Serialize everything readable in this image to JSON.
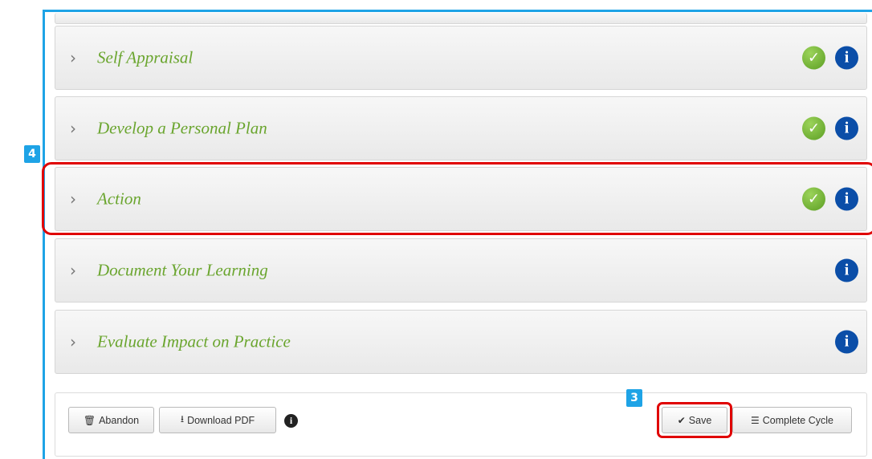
{
  "steps": [
    {
      "title": "Self Appraisal",
      "complete": true
    },
    {
      "title": "Develop a Personal Plan",
      "complete": true
    },
    {
      "title": "Action",
      "complete": true
    },
    {
      "title": "Document Your Learning",
      "complete": false
    },
    {
      "title": "Evaluate Impact on Practice",
      "complete": false
    }
  ],
  "footer": {
    "abandon_label": "Abandon",
    "download_label": "Download PDF",
    "save_label": "Save",
    "complete_label": "Complete Cycle"
  },
  "badges": {
    "step_badge": "4",
    "save_badge": "3"
  },
  "colors": {
    "accent": "#1ea3e6",
    "highlight": "#e00000",
    "step_title": "#6aa52e",
    "info": "#0b4ea8"
  }
}
